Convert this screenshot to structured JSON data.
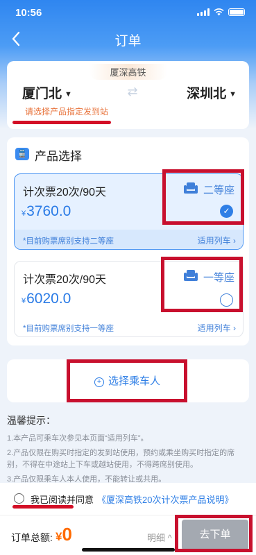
{
  "status_bar": {
    "time": "10:56"
  },
  "nav": {
    "title": "订单",
    "back_icon": "chevron-left-icon"
  },
  "route": {
    "tag": "厦深高铁",
    "from": "厦门北",
    "to": "深圳北",
    "hint": "请选择产品指定发到站"
  },
  "products": {
    "section_title": "产品选择",
    "options": [
      {
        "name": "计次票20次/90天",
        "currency": "¥",
        "price": "3760.0",
        "seat": "二等座",
        "note": "*目前购票席别支持二等座",
        "link": "适用列车 ›",
        "selected": true
      },
      {
        "name": "计次票20次/90天",
        "currency": "¥",
        "price": "6020.0",
        "seat": "一等座",
        "note": "*目前购票席别支持一等座",
        "link": "适用列车 ›",
        "selected": false
      }
    ]
  },
  "passenger": {
    "label": "选择乘车人"
  },
  "tips": {
    "title": "温馨提示：",
    "items": [
      "1.本产品可乘车次参见本页面“适用列车”。",
      "2.产品仅限在购买时指定的发到站使用，预约或乘坐购买时指定的席别，不得在中途站上下车或越站使用，不得跨席别使用。",
      "3.产品仅限乘车人本人使用，不能转让或共用。"
    ]
  },
  "agreement": {
    "text": "我已阅读并同意",
    "link": "《厦深高铁20次计次票产品说明》"
  },
  "bottom": {
    "total_label": "订单总额:",
    "currency": "¥",
    "amount": "0",
    "detail": "明细 ^",
    "submit": "去下单"
  },
  "colors": {
    "primary": "#2f7fe6",
    "annotation_red": "#c8102e",
    "price_orange": "#ff6a00",
    "hint_orange": "#e8733b"
  }
}
